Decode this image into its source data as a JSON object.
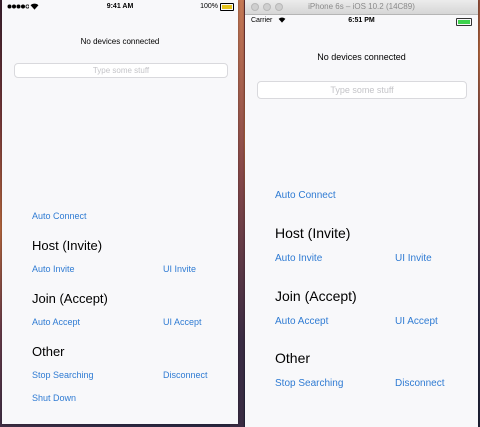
{
  "left_device": {
    "status": {
      "time": "9:41 AM",
      "battery_text": "100%"
    },
    "app": {
      "status_text": "No devices connected",
      "text_field_placeholder": "Type some stuff",
      "auto_connect": "Auto Connect",
      "host_title": "Host (Invite)",
      "auto_invite": "Auto Invite",
      "ui_invite": "UI Invite",
      "join_title": "Join (Accept)",
      "auto_accept": "Auto Accept",
      "ui_accept": "UI Accept",
      "other_title": "Other",
      "stop_searching": "Stop Searching",
      "disconnect": "Disconnect",
      "shut_down": "Shut Down"
    }
  },
  "right_device": {
    "window_title": "iPhone 6s – iOS 10.2 (14C89)",
    "status": {
      "carrier": "Carrier",
      "time": "6:51 PM"
    },
    "app": {
      "status_text": "No devices connected",
      "text_field_placeholder": "Type some stuff",
      "auto_connect": "Auto Connect",
      "host_title": "Host (Invite)",
      "auto_invite": "Auto Invite",
      "ui_invite": "UI Invite",
      "join_title": "Join (Accept)",
      "auto_accept": "Auto Accept",
      "ui_accept": "UI Accept",
      "other_title": "Other",
      "stop_searching": "Stop Searching",
      "disconnect": "Disconnect"
    }
  },
  "colors": {
    "link": "#2f7bd3",
    "left_battery": "#e4c21b",
    "right_battery": "#3dd34d"
  },
  "icons": [
    "signal-dots-icon",
    "wifi-icon",
    "battery-icon",
    "close-window-icon",
    "minimize-window-icon",
    "zoom-window-icon"
  ]
}
